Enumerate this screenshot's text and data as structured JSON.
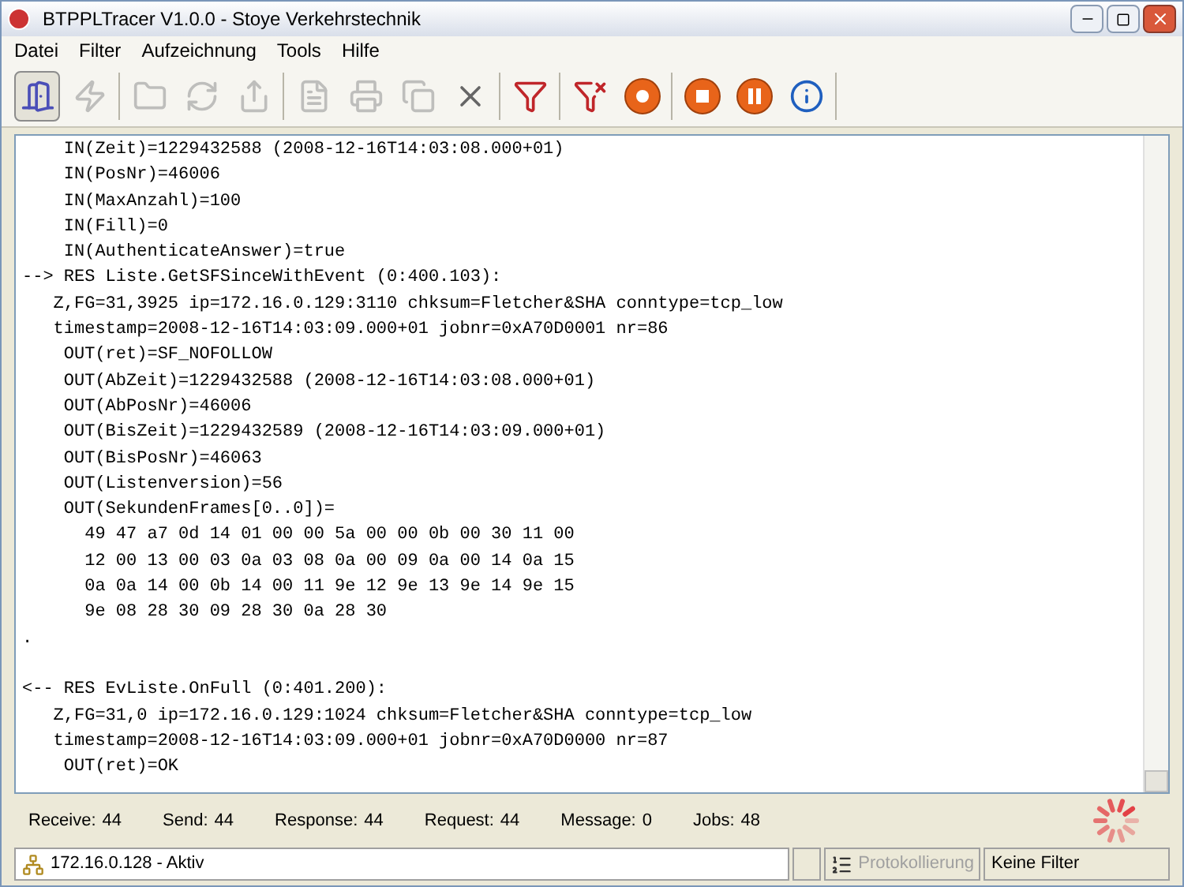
{
  "window": {
    "title": "BTPPLTracer V1.0.0 - Stoye Verkehrstechnik"
  },
  "menu": [
    "Datei",
    "Filter",
    "Aufzeichnung",
    "Tools",
    "Hilfe"
  ],
  "toolbar": [
    {
      "kind": "door",
      "disabled": false,
      "selected": true
    },
    {
      "kind": "bolt",
      "disabled": true,
      "selected": false
    },
    {
      "kind": "folder",
      "disabled": true,
      "selected": false
    },
    {
      "kind": "refresh",
      "disabled": true,
      "selected": false
    },
    {
      "kind": "export",
      "disabled": true,
      "selected": false
    },
    {
      "kind": "word",
      "disabled": true,
      "selected": false
    },
    {
      "kind": "print",
      "disabled": true,
      "selected": false
    },
    {
      "kind": "copy",
      "disabled": true,
      "selected": false
    },
    {
      "kind": "clear",
      "disabled": false,
      "selected": false
    },
    {
      "kind": "filter",
      "disabled": false,
      "selected": false
    },
    {
      "kind": "filteroff",
      "disabled": false,
      "selected": false
    },
    {
      "kind": "record",
      "disabled": false,
      "selected": false
    },
    {
      "kind": "stop",
      "disabled": false,
      "selected": false
    },
    {
      "kind": "pause",
      "disabled": false,
      "selected": false
    },
    {
      "kind": "info",
      "disabled": false,
      "selected": false
    }
  ],
  "log": [
    [
      "    IN(Zeit)=1229432588 (2008-12-16T14:03:08.000+01)",
      "    IN(PosNr)=46006",
      "    IN(MaxAnzahl)=100",
      "    IN(Fill)=0",
      "    IN(AuthenticateAnswer)=true",
      "--> RES Liste.GetSFSinceWithEvent (0:400.103):",
      "   Z,FG=31,3925 ip=172.16.0.129:3110 chksum=Fletcher&SHA conntype=tcp_low",
      "   timestamp=2008-12-16T14:03:09.000+01 jobnr=0xA70D0001 nr=86",
      "    OUT(ret)=SF_NOFOLLOW",
      "    OUT(AbZeit)=1229432588 (2008-12-16T14:03:08.000+01)",
      "    OUT(AbPosNr)=46006",
      "    OUT(BisZeit)=1229432589 (2008-12-16T14:03:09.000+01)",
      "    OUT(BisPosNr)=46063",
      "    OUT(Listenversion)=56",
      "    OUT(SekundenFrames[0..0])=",
      "      49 47 a7 0d 14 01 00 00 5a 00 00 0b 00 30 11 00",
      "      12 00 13 00 03 0a 03 08 0a 00 09 0a 00 14 0a 15",
      "      0a 0a 14 00 0b 14 00 11 9e 12 9e 13 9e 14 9e 15",
      "      9e 08 28 30 09 28 30 0a 28 30",
      "."
    ],
    [
      "<-- RES EvListe.OnFull (0:401.200):",
      "   Z,FG=31,0 ip=172.16.0.129:1024 chksum=Fletcher&SHA conntype=tcp_low",
      "   timestamp=2008-12-16T14:03:09.000+01 jobnr=0xA70D0000 nr=87",
      "    OUT(ret)=OK"
    ]
  ],
  "counters": [
    {
      "label": "Receive:",
      "value": "44"
    },
    {
      "label": "Send:",
      "value": "44"
    },
    {
      "label": "Response:",
      "value": "44"
    },
    {
      "label": "Request:",
      "value": "44"
    },
    {
      "label": "Message:",
      "value": "0"
    },
    {
      "label": "Jobs:",
      "value": "48"
    }
  ],
  "status_bar": {
    "connection": "172.16.0.128 - Aktiv",
    "logging": {
      "label": "Protokollierung",
      "disabled": true
    },
    "filter": "Keine Filter"
  }
}
